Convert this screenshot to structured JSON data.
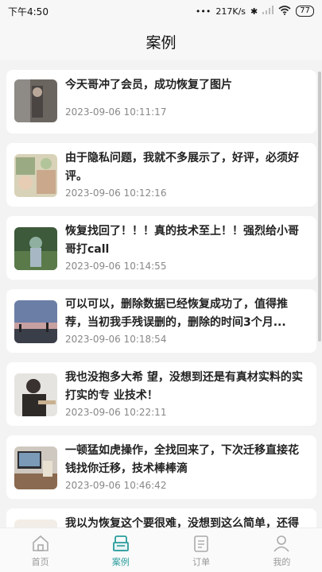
{
  "status_bar": {
    "time": "下午4:50",
    "network_speed": "217K/s",
    "battery": "77"
  },
  "header": {
    "title": "案例"
  },
  "cases": [
    {
      "text": "今天哥冲了会员，成功恢复了图片",
      "time": "2023-09-06 10:11:17"
    },
    {
      "text": "由于隐私问题，我就不多展示了，好评，必须好评。",
      "time": "2023-09-06 10:12:16"
    },
    {
      "text": "恢复找回了！！！真的技术至上！！强烈给小哥哥打call",
      "time": "2023-09-06 10:14:55"
    },
    {
      "text": "可以可以，删除数据已经恢复成功了，值得推荐，当初我手残误删的，删除的时间3个月...",
      "time": "2023-09-06 10:18:54"
    },
    {
      "text": "我也没抱多大希 望，没想到还是有真材实料的实打实的专 业技术！",
      "time": "2023-09-06 10:22:11"
    },
    {
      "text": "一顿猛如虎操作，全找回来了，下次迁移直接花钱找你迁移，技术棒棒滴",
      "time": "2023-09-06 10:46:42"
    },
    {
      "text": "我以为恢复这个要很难，没想到这么简单，还得找专业的",
      "time": ""
    }
  ],
  "tabs": [
    {
      "label": "首页",
      "icon": "home-icon"
    },
    {
      "label": "案例",
      "icon": "case-icon"
    },
    {
      "label": "订单",
      "icon": "order-icon"
    },
    {
      "label": "我的",
      "icon": "profile-icon"
    }
  ],
  "colors": {
    "accent": "#2a9c9c",
    "inactive": "#999999"
  }
}
